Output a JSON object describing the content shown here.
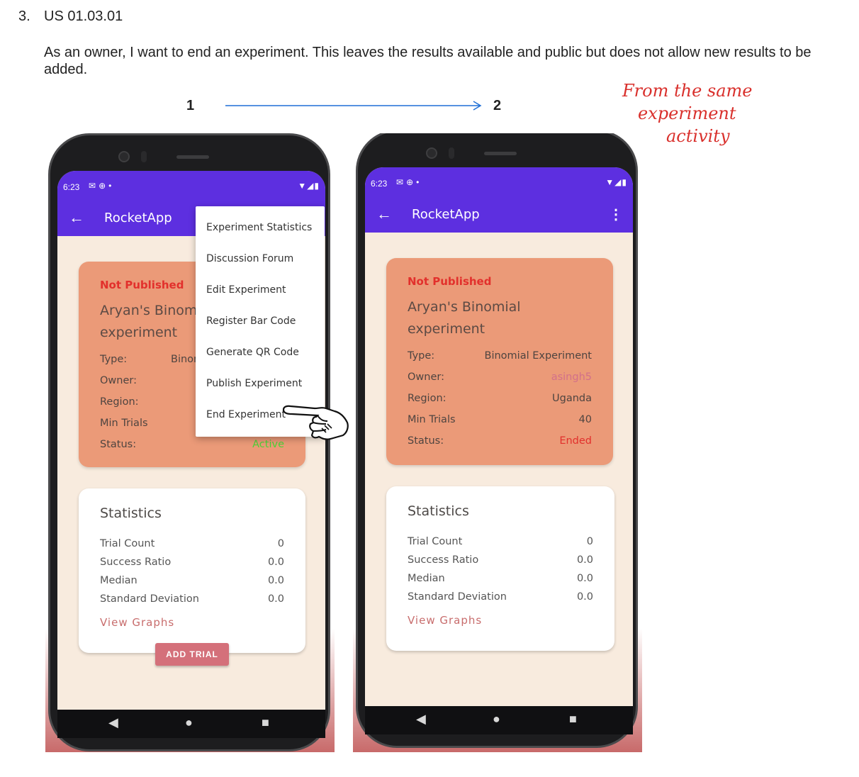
{
  "document": {
    "list_number": "3.",
    "story_id": "US 01.03.01",
    "story_text": "As an owner, I want to end an experiment. This leaves the results available and public but does not allow new results to be added.",
    "step_1": "1",
    "step_2": "2",
    "note_line1": "From the same",
    "note_line2": "experiment",
    "note_line3": "activity"
  },
  "phone1": {
    "time": "6:23",
    "app_title": "RocketApp",
    "publish_state": "Not Published",
    "experiment_title": "Aryan's Binomial experiment",
    "type_label": "Type:",
    "type_value": "Binomial Experiment",
    "owner_label": "Owner:",
    "region_label": "Region:",
    "min_trials_label": "Min Trials",
    "status_label": "Status:",
    "status_value": "Active",
    "menu": [
      "Experiment Statistics",
      "Discussion Forum",
      "Edit Experiment",
      "Register Bar Code",
      "Generate QR Code",
      "Publish Experiment",
      "End Experiment"
    ],
    "stats_title": "Statistics",
    "stats": [
      {
        "label": "Trial Count",
        "value": "0"
      },
      {
        "label": "Success Ratio",
        "value": "0.0"
      },
      {
        "label": "Median",
        "value": "0.0"
      },
      {
        "label": "Standard Deviation",
        "value": "0.0"
      }
    ],
    "view_graphs": "View Graphs",
    "add_trial": "ADD TRIAL"
  },
  "phone2": {
    "time": "6:23",
    "app_title": "RocketApp",
    "publish_state": "Not Published",
    "experiment_title": "Aryan's Binomial experiment",
    "type_label": "Type:",
    "type_value": "Binomial Experiment",
    "owner_label": "Owner:",
    "owner_value": "asingh5",
    "region_label": "Region:",
    "region_value": "Uganda",
    "min_trials_label": "Min Trials",
    "min_trials_value": "40",
    "status_label": "Status:",
    "status_value": "Ended",
    "stats_title": "Statistics",
    "stats": [
      {
        "label": "Trial Count",
        "value": "0"
      },
      {
        "label": "Success Ratio",
        "value": "0.0"
      },
      {
        "label": "Median",
        "value": "0.0"
      },
      {
        "label": "Standard Deviation",
        "value": "0.0"
      }
    ],
    "view_graphs": "View Graphs"
  },
  "colors": {
    "appbar": "#5d2fe0",
    "card": "#eb9a78",
    "not_published": "#e2302c",
    "status_active": "#4cd137",
    "status_ended": "#e2302c",
    "owner_link": "#d2708a",
    "note_ink": "#d9302c",
    "arrow": "#1f6fd6"
  },
  "icons": [
    "back-arrow-icon",
    "more-vert-icon",
    "wifi-icon",
    "signal-icon",
    "battery-icon",
    "mail-icon",
    "globe-icon",
    "nav-back-icon",
    "nav-home-icon",
    "nav-recents-icon",
    "pointing-hand-icon"
  ]
}
